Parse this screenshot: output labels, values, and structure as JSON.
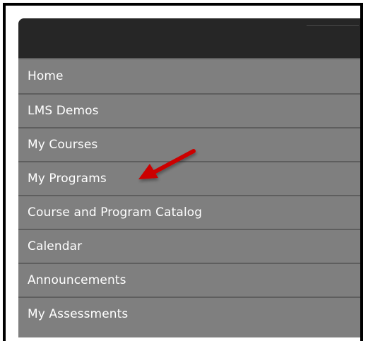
{
  "menu": {
    "items": [
      {
        "label": "Home"
      },
      {
        "label": "LMS Demos"
      },
      {
        "label": "My Courses"
      },
      {
        "label": "My Programs"
      },
      {
        "label": "Course and Program Catalog"
      },
      {
        "label": "Calendar"
      },
      {
        "label": "Announcements"
      },
      {
        "label": "My Assessments"
      }
    ]
  },
  "colors": {
    "header": "#262626",
    "item_background": "#7f7f7f",
    "item_text": "#ffffff",
    "arrow": "#cc0000"
  },
  "annotation": {
    "icon": "red-arrow-icon",
    "points_to": "My Programs"
  }
}
